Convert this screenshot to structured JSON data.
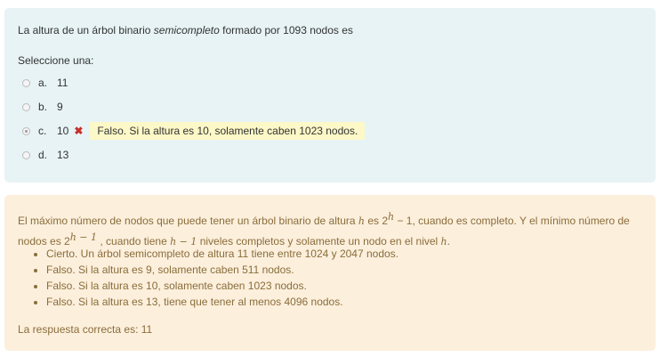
{
  "question": {
    "text_before": "La altura de un árbol binario ",
    "text_emph": "semicompleto",
    "text_after": " formado por 1093 nodos es",
    "prompt": "Seleccione una:",
    "options": [
      {
        "letter": "a.",
        "value": "11",
        "selected": false
      },
      {
        "letter": "b.",
        "value": "9",
        "selected": false
      },
      {
        "letter": "c.",
        "value": "10",
        "selected": true,
        "mark": "✖",
        "feedback": "Falso. Si la altura es 10, solamente caben 1023 nodos."
      },
      {
        "letter": "d.",
        "value": "13",
        "selected": false
      }
    ]
  },
  "general_feedback": {
    "p1_a": "El máximo número de nodos que puede tener un árbol binario de altura ",
    "h": "h",
    "p1_b": " es 2",
    "p1_c": " − 1, cuando es completo. Y el mínimo número de nodos es 2",
    "exp2": "h − 1",
    "p1_d": " , cuando tiene ",
    "h_minus_1": "h − 1",
    "p1_e": " niveles completos y solamente un nodo en el nivel ",
    "p1_f": ".",
    "bullets": [
      "Cierto. Un árbol semicompleto de altura 11 tiene entre 1024 y 2047 nodos.",
      "Falso. Si la altura es 9, solamente caben 511 nodos.",
      "Falso. Si la altura es 10, solamente caben 1023 nodos.",
      "Falso. Si la altura es 13, tiene que tener al menos 4096 nodos."
    ],
    "correct_answer": "La respuesta correcta es: 11"
  }
}
